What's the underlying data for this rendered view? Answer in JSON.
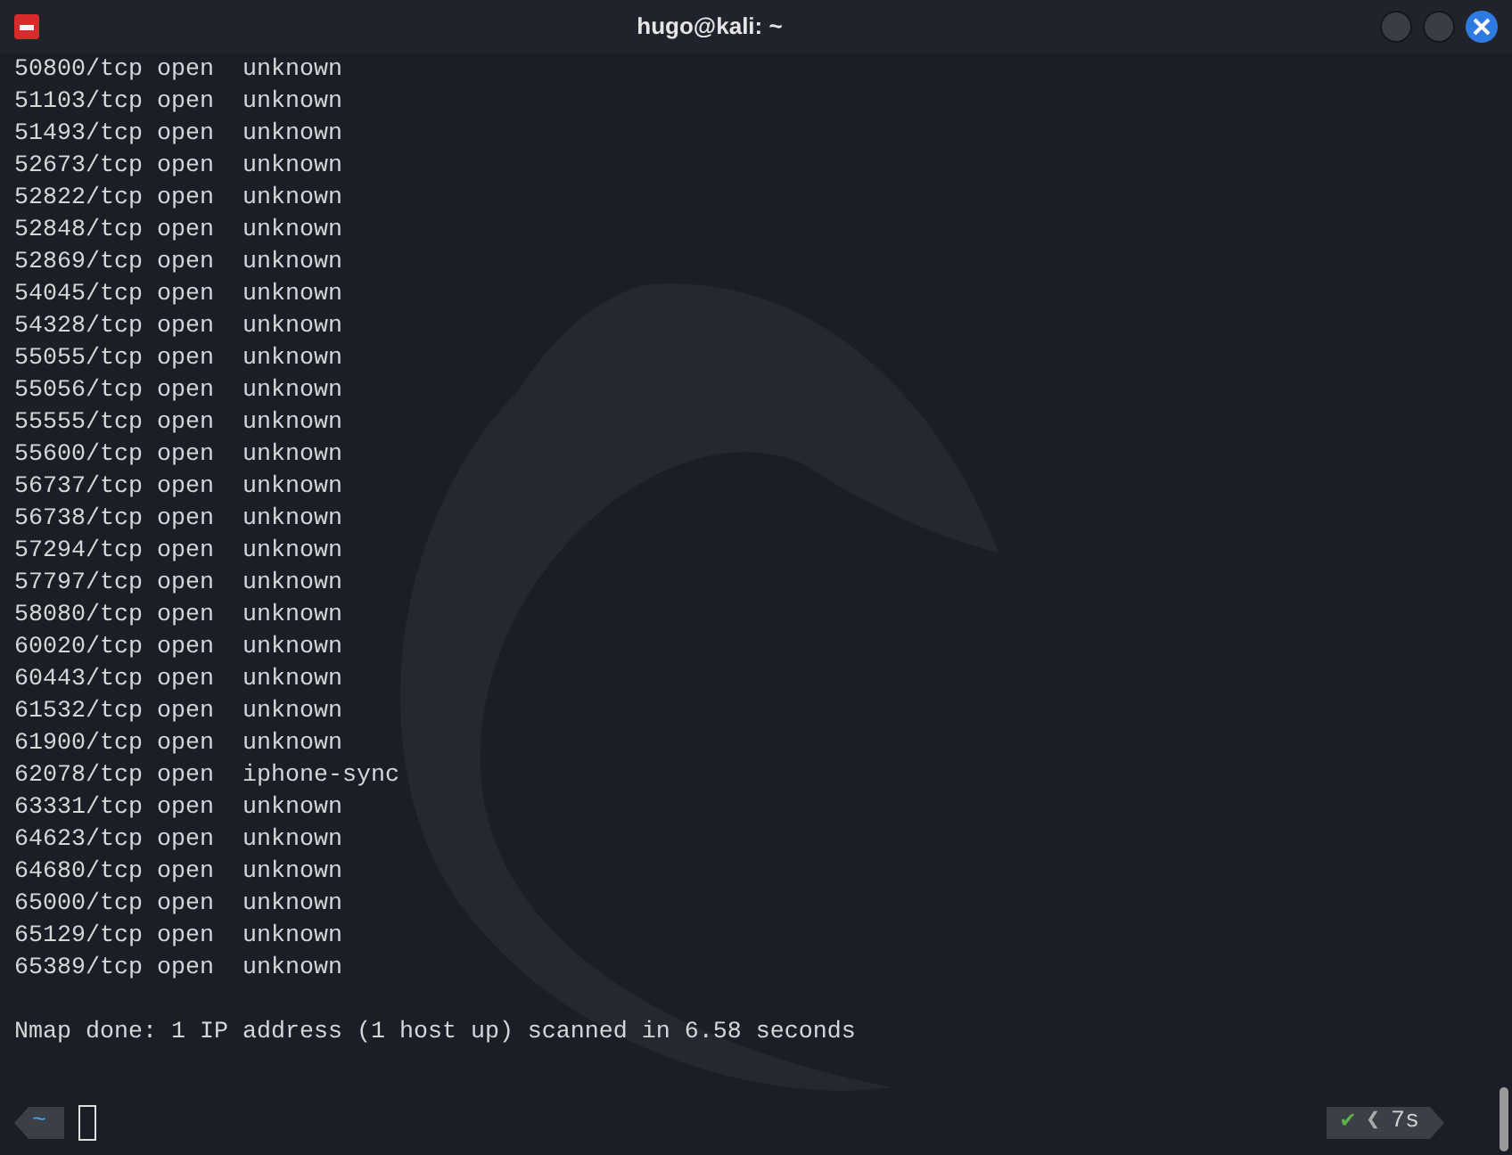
{
  "window": {
    "title": "hugo@kali: ~"
  },
  "lines": [
    "50800/tcp open  unknown",
    "51103/tcp open  unknown",
    "51493/tcp open  unknown",
    "52673/tcp open  unknown",
    "52822/tcp open  unknown",
    "52848/tcp open  unknown",
    "52869/tcp open  unknown",
    "54045/tcp open  unknown",
    "54328/tcp open  unknown",
    "55055/tcp open  unknown",
    "55056/tcp open  unknown",
    "55555/tcp open  unknown",
    "55600/tcp open  unknown",
    "56737/tcp open  unknown",
    "56738/tcp open  unknown",
    "57294/tcp open  unknown",
    "57797/tcp open  unknown",
    "58080/tcp open  unknown",
    "60020/tcp open  unknown",
    "60443/tcp open  unknown",
    "61532/tcp open  unknown",
    "61900/tcp open  unknown",
    "62078/tcp open  iphone-sync",
    "63331/tcp open  unknown",
    "64623/tcp open  unknown",
    "64680/tcp open  unknown",
    "65000/tcp open  unknown",
    "65129/tcp open  unknown",
    "65389/tcp open  unknown"
  ],
  "summary": "Nmap done: 1 IP address (1 host up) scanned in 6.58 seconds",
  "prompt": {
    "directory": "~",
    "status_mark": "✔",
    "separator": "❮",
    "duration": "7s"
  }
}
